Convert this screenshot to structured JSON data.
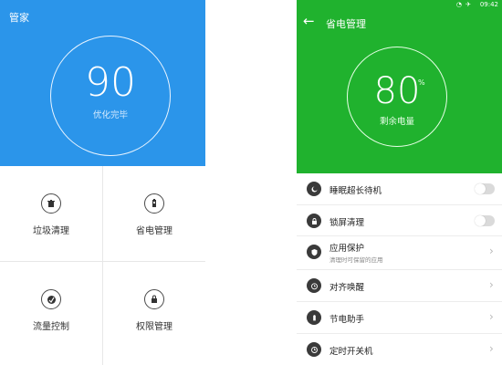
{
  "left": {
    "title": "管家",
    "score": "90",
    "score_label": "优化完毕",
    "tiles": [
      {
        "label": "垃圾清理",
        "icon": "trash-icon"
      },
      {
        "label": "省电管理",
        "icon": "battery-icon"
      },
      {
        "label": "流量控制",
        "icon": "traffic-icon"
      },
      {
        "label": "权限管理",
        "icon": "lock-icon"
      }
    ],
    "colors": {
      "header": "#2b95ea"
    }
  },
  "right": {
    "status_time": "09:42",
    "title": "省电管理",
    "score": "80",
    "score_unit": "%",
    "score_label": "剩余电量",
    "items": [
      {
        "title": "睡眠超长待机",
        "sub": "",
        "control": "toggle",
        "icon": "sleep-icon"
      },
      {
        "title": "锁屏清理",
        "sub": "",
        "control": "toggle",
        "icon": "lock-clean-icon"
      },
      {
        "title": "应用保护",
        "sub": "清理时可保留的应用",
        "control": "chevron",
        "icon": "shield-icon"
      },
      {
        "title": "对齐唤醒",
        "sub": "",
        "control": "chevron",
        "icon": "alarm-icon"
      },
      {
        "title": "节电助手",
        "sub": "",
        "control": "chevron",
        "icon": "power-saver-icon"
      },
      {
        "title": "定时开关机",
        "sub": "",
        "control": "chevron",
        "icon": "timer-power-icon"
      }
    ],
    "colors": {
      "header": "#20b22e"
    }
  }
}
